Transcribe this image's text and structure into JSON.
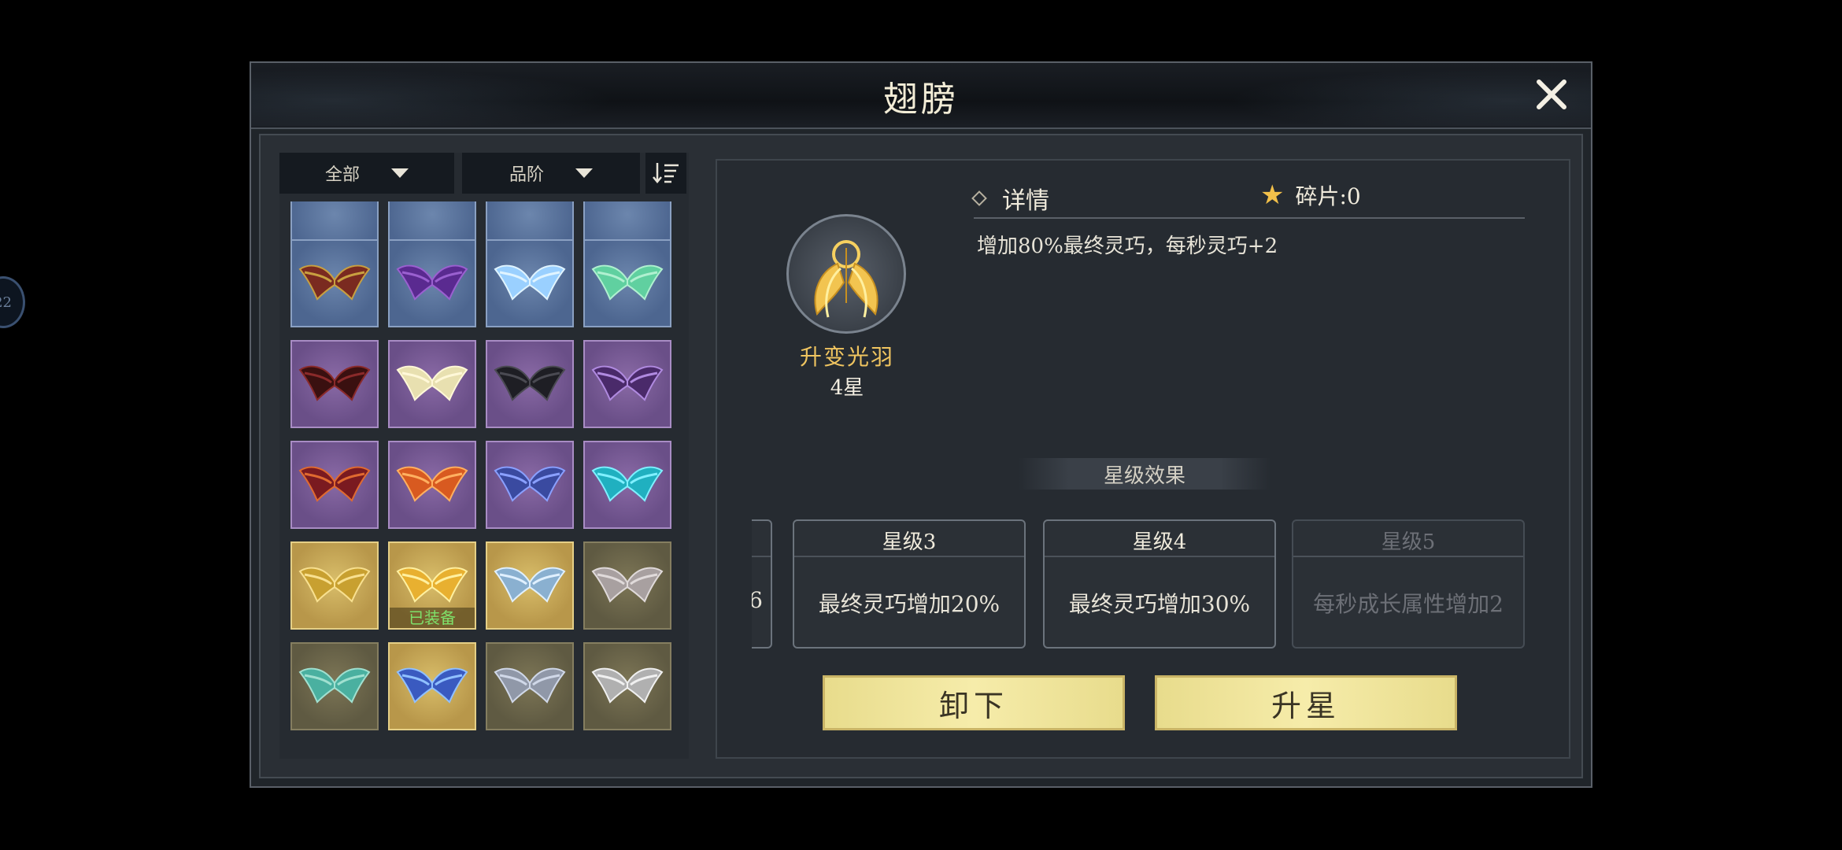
{
  "side_badge": "22",
  "window": {
    "title": "翅膀",
    "close_icon": "close-icon"
  },
  "filters": {
    "category": "全部",
    "quality": "品阶",
    "sort_icon": "sort-icon"
  },
  "wings": [
    {
      "quality": "blue",
      "colors": [
        "#7a2a20",
        "#c8a040"
      ],
      "equipped": false
    },
    {
      "quality": "blue",
      "colors": [
        "#5a2a90",
        "#9a60d0"
      ],
      "equipped": false
    },
    {
      "quality": "blue",
      "colors": [
        "#9ad0ff",
        "#e0f4ff"
      ],
      "equipped": false
    },
    {
      "quality": "blue",
      "colors": [
        "#60d0a0",
        "#b0f0d0"
      ],
      "equipped": false
    },
    {
      "quality": "purple",
      "colors": [
        "#3a1010",
        "#8a2a2a"
      ],
      "equipped": false
    },
    {
      "quality": "purple",
      "colors": [
        "#e8e0b0",
        "#fff8d8"
      ],
      "equipped": false
    },
    {
      "quality": "purple",
      "colors": [
        "#1e1e24",
        "#4a4a52"
      ],
      "equipped": false
    },
    {
      "quality": "purple",
      "colors": [
        "#4a2a6a",
        "#b08ae0"
      ],
      "equipped": false
    },
    {
      "quality": "purple",
      "colors": [
        "#7a1a20",
        "#e06a30"
      ],
      "equipped": false
    },
    {
      "quality": "purple",
      "colors": [
        "#d85a20",
        "#ffb060"
      ],
      "equipped": false
    },
    {
      "quality": "purple",
      "colors": [
        "#3a4aa0",
        "#8aa0ff"
      ],
      "equipped": false
    },
    {
      "quality": "purple",
      "colors": [
        "#20b0c0",
        "#80f0ff"
      ],
      "equipped": false
    },
    {
      "quality": "gold",
      "colors": [
        "#c8a030",
        "#f8e090"
      ],
      "equipped": false
    },
    {
      "quality": "gold",
      "colors": [
        "#e8b030",
        "#fff0a0"
      ],
      "equipped": true
    },
    {
      "quality": "gold",
      "colors": [
        "#8ab0d0",
        "#e0f0ff"
      ],
      "equipped": false
    },
    {
      "quality": "dim",
      "colors": [
        "#a8a0a0",
        "#e0dada"
      ],
      "equipped": false
    },
    {
      "quality": "dim",
      "colors": [
        "#4ab0a0",
        "#a0e0d0"
      ],
      "equipped": false
    },
    {
      "quality": "gold",
      "colors": [
        "#3a5ac0",
        "#90c0ff"
      ],
      "equipped": false
    },
    {
      "quality": "dim",
      "colors": [
        "#9098a8",
        "#d0d8e8"
      ],
      "equipped": false
    },
    {
      "quality": "dim",
      "colors": [
        "#b0b0b0",
        "#f0f0f0"
      ],
      "equipped": false
    }
  ],
  "equipped_label": "已装备",
  "detail": {
    "tab_label": "详情",
    "fragments_label": "碎片:0",
    "description": "增加80%最终灵巧，每秒灵巧+2",
    "item_name": "升变光羽",
    "item_star": "4星",
    "effect_title": "星级效果",
    "star_levels": [
      {
        "level": "",
        "effect": "6",
        "locked": false
      },
      {
        "level": "星级3",
        "effect": "最终灵巧增加20%",
        "locked": false
      },
      {
        "level": "星级4",
        "effect": "最终灵巧增加30%",
        "locked": false
      },
      {
        "level": "星级5",
        "effect": "每秒成长属性增加2",
        "locked": true
      }
    ],
    "buttons": {
      "unequip": "卸下",
      "star_up": "升星"
    }
  }
}
